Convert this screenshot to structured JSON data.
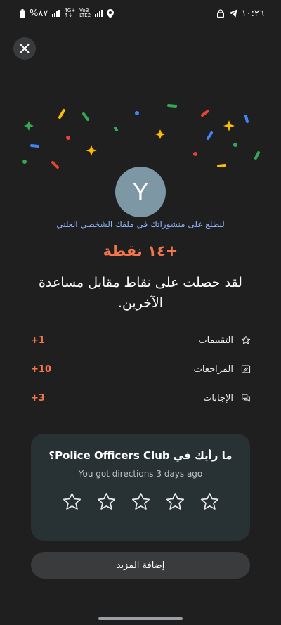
{
  "status_bar": {
    "battery_text": "%٨٧",
    "network_top": "4G+",
    "network_bottom": "↑↓",
    "volte_top": "VoB",
    "volte_bottom": "LTE2",
    "time": "١٠:٢٦"
  },
  "header": {
    "close_icon": "close-icon"
  },
  "profile": {
    "avatar_letter": "Y",
    "link_text": "لنطلع على منشوراتك في ملفك الشخصي العلني"
  },
  "points": {
    "title": "+١٤ نقطة",
    "description": "لقد حصلت على نقاط مقابل مساعدة الآخرين."
  },
  "stats": [
    {
      "label": "التقييمات",
      "value": "+1",
      "icon": "star-outline-icon"
    },
    {
      "label": "المراجعات",
      "value": "+10",
      "icon": "review-icon"
    },
    {
      "label": "الإجابات",
      "value": "+3",
      "icon": "answers-icon"
    }
  ],
  "rating_card": {
    "title": "ما رأيك في Police Officers Club؟",
    "subtitle": "You got directions 3 days ago",
    "star_count": 5
  },
  "more_button": {
    "label": "إضافة المزيد"
  },
  "colors": {
    "background": "#1f1f1f",
    "accent_orange": "#f5764d",
    "link_blue": "#8ab4f8",
    "card": "#283133",
    "avatar": "#7e97a5"
  }
}
